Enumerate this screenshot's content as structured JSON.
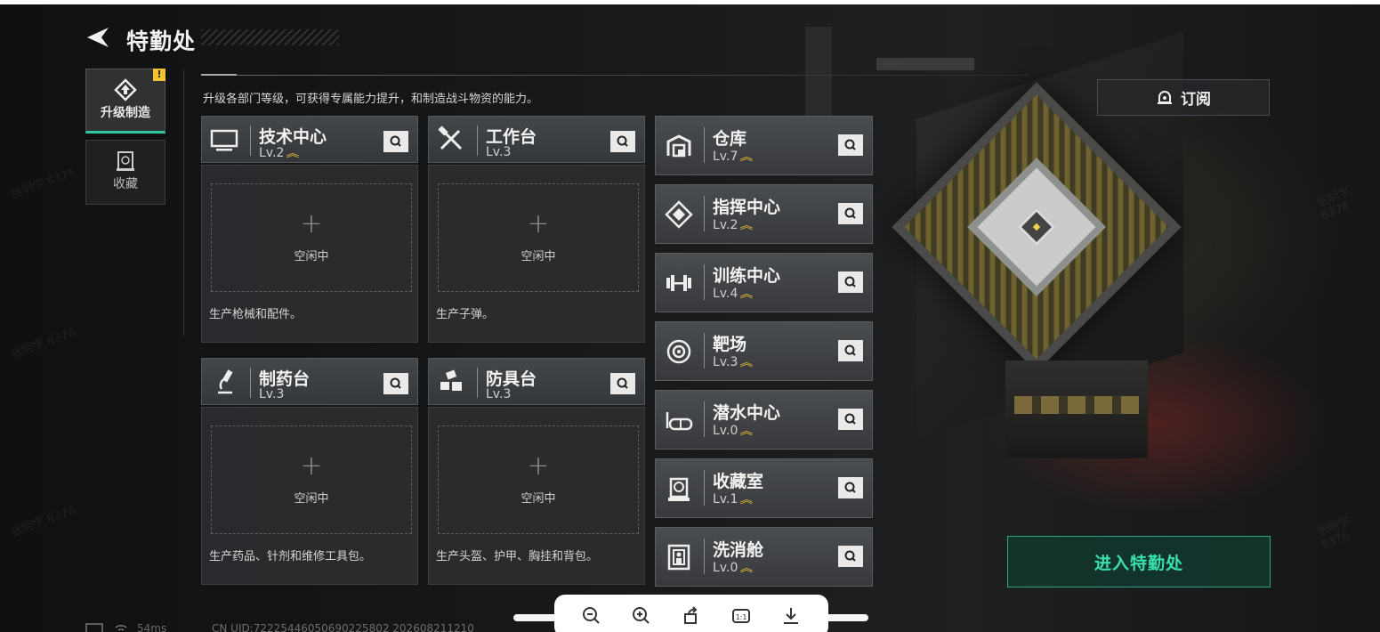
{
  "header": {
    "title": "特勤处"
  },
  "sidebar": {
    "items": [
      {
        "label": "升级制造",
        "badge": "!"
      },
      {
        "label": "收藏"
      }
    ]
  },
  "main": {
    "description": "升级各部门等级，可获得专属能力提升，和制造战斗物资的能力。",
    "subscribe_label": "订阅",
    "production_cards": [
      {
        "name": "技术中心",
        "level": "Lv.2",
        "upgradable": true,
        "slot_status": "空闲中",
        "description": "生产枪械和配件。",
        "icon": "monitor-icon"
      },
      {
        "name": "工作台",
        "level": "Lv.3",
        "upgradable": false,
        "slot_status": "空闲中",
        "description": "生产子弹。",
        "icon": "tools-icon"
      },
      {
        "name": "制药台",
        "level": "Lv.3",
        "upgradable": false,
        "slot_status": "空闲中",
        "description": "生产药品、针剂和维修工具包。",
        "icon": "microscope-icon"
      },
      {
        "name": "防具台",
        "level": "Lv.3",
        "upgradable": false,
        "slot_status": "空闲中",
        "description": "生产头盔、护甲、胸挂和背包。",
        "icon": "armor-parts-icon"
      }
    ],
    "facilities": [
      {
        "name": "仓库",
        "level": "Lv.7",
        "upgradable": true,
        "icon": "warehouse-icon"
      },
      {
        "name": "指挥中心",
        "level": "Lv.2",
        "upgradable": true,
        "icon": "command-icon"
      },
      {
        "name": "训练中心",
        "level": "Lv.4",
        "upgradable": true,
        "icon": "dumbbell-icon"
      },
      {
        "name": "靶场",
        "level": "Lv.3",
        "upgradable": true,
        "icon": "target-icon"
      },
      {
        "name": "潜水中心",
        "level": "Lv.0",
        "upgradable": true,
        "icon": "diving-mask-icon"
      },
      {
        "name": "收藏室",
        "level": "Lv.1",
        "upgradable": true,
        "icon": "collection-icon"
      },
      {
        "name": "洗消舱",
        "level": "Lv.0",
        "upgradable": true,
        "icon": "decon-icon"
      }
    ],
    "enter_button": "进入特勤处"
  },
  "footer": {
    "ping": "54ms",
    "uid": "CN UID:722254460506902258​02 20260821121​0"
  },
  "watermark_text": "张明宇 8376",
  "colors": {
    "accent": "#2fc7a0",
    "enter_text": "#39e0ae",
    "upgrade": "#f2c230",
    "badge": "#f2c230"
  },
  "viewer_toolbar": [
    "zoom-out-icon",
    "zoom-in-icon",
    "rotate-icon",
    "fit-icon",
    "download-icon"
  ]
}
